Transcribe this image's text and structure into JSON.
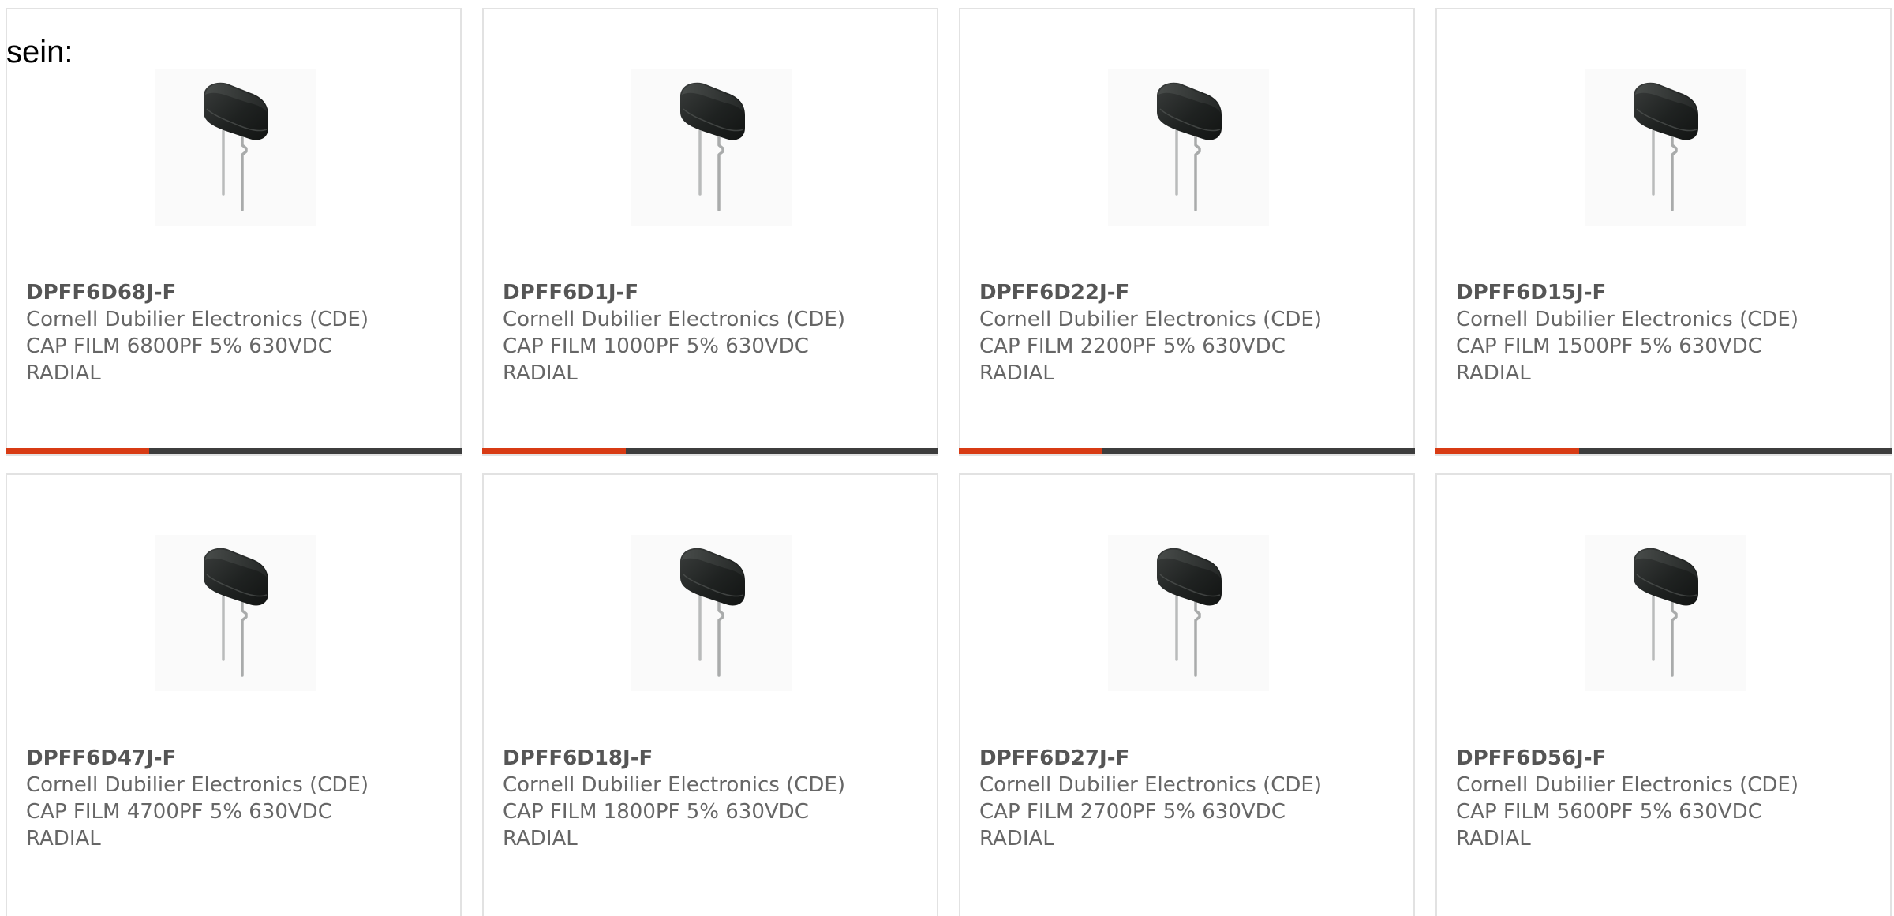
{
  "intro_text": "sein:",
  "colors": {
    "accent": "#d83b14",
    "bar": "#3d3d3d",
    "border": "#e2e2e2",
    "text": "#666666"
  },
  "products": [
    {
      "part_number": "DPFF6D68J-F",
      "manufacturer": "Cornell Dubilier Electronics (CDE)",
      "description_line1": "CAP FILM 6800PF 5% 630VDC",
      "description_line2": "RADIAL",
      "image": "capacitor-image"
    },
    {
      "part_number": "DPFF6D1J-F",
      "manufacturer": "Cornell Dubilier Electronics (CDE)",
      "description_line1": "CAP FILM 1000PF 5% 630VDC",
      "description_line2": "RADIAL",
      "image": "capacitor-image"
    },
    {
      "part_number": "DPFF6D22J-F",
      "manufacturer": "Cornell Dubilier Electronics (CDE)",
      "description_line1": "CAP FILM 2200PF 5% 630VDC",
      "description_line2": "RADIAL",
      "image": "capacitor-image"
    },
    {
      "part_number": "DPFF6D15J-F",
      "manufacturer": "Cornell Dubilier Electronics (CDE)",
      "description_line1": "CAP FILM 1500PF 5% 630VDC",
      "description_line2": "RADIAL",
      "image": "capacitor-image"
    },
    {
      "part_number": "DPFF6D47J-F",
      "manufacturer": "Cornell Dubilier Electronics (CDE)",
      "description_line1": "CAP FILM 4700PF 5% 630VDC",
      "description_line2": "RADIAL",
      "image": "capacitor-image"
    },
    {
      "part_number": "DPFF6D18J-F",
      "manufacturer": "Cornell Dubilier Electronics (CDE)",
      "description_line1": "CAP FILM 1800PF 5% 630VDC",
      "description_line2": "RADIAL",
      "image": "capacitor-image"
    },
    {
      "part_number": "DPFF6D27J-F",
      "manufacturer": "Cornell Dubilier Electronics (CDE)",
      "description_line1": "CAP FILM 2700PF 5% 630VDC",
      "description_line2": "RADIAL",
      "image": "capacitor-image"
    },
    {
      "part_number": "DPFF6D56J-F",
      "manufacturer": "Cornell Dubilier Electronics (CDE)",
      "description_line1": "CAP FILM 5600PF 5% 630VDC",
      "description_line2": "RADIAL",
      "image": "capacitor-image"
    }
  ]
}
